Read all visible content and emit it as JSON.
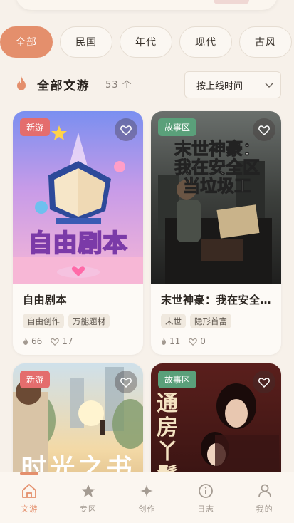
{
  "filters": [
    {
      "label": "全部",
      "active": true
    },
    {
      "label": "民国",
      "active": false
    },
    {
      "label": "年代",
      "active": false
    },
    {
      "label": "现代",
      "active": false
    },
    {
      "label": "古风",
      "active": false
    }
  ],
  "section": {
    "title": "全部文游",
    "count": "53 个",
    "sort_value": "按上线时间"
  },
  "cards": [
    {
      "badge": "新游",
      "cover_text": "自由剧本",
      "title": "自由剧本",
      "tags": [
        "自由创作",
        "万能题材"
      ],
      "plays": "66",
      "likes": "17"
    },
    {
      "badge": "故事区",
      "cover_text": "末世神豪：我在安全区当垃圾工",
      "title": "末世神豪：我在安全区当垃圾工",
      "tags": [
        "末世",
        "隐形首富"
      ],
      "plays": "11",
      "likes": "0"
    },
    {
      "badge": "新游",
      "cover_text": "时光之书",
      "title": "",
      "tags": [],
      "plays": "",
      "likes": ""
    },
    {
      "badge": "故事区",
      "cover_text": "通房丫鬟",
      "title": "",
      "tags": [],
      "plays": "",
      "likes": ""
    }
  ],
  "nav": [
    {
      "label": "文游",
      "icon": "home-icon",
      "active": true
    },
    {
      "label": "专区",
      "icon": "star-icon",
      "active": false
    },
    {
      "label": "创作",
      "icon": "sparkle-icon",
      "active": false
    },
    {
      "label": "日志",
      "icon": "info-icon",
      "active": false
    },
    {
      "label": "我的",
      "icon": "user-icon",
      "active": false
    }
  ],
  "colors": {
    "accent": "#e48f6c",
    "background": "#f7f1ea",
    "badge_new": "#e46d6d",
    "badge_story": "#5aa07a"
  }
}
